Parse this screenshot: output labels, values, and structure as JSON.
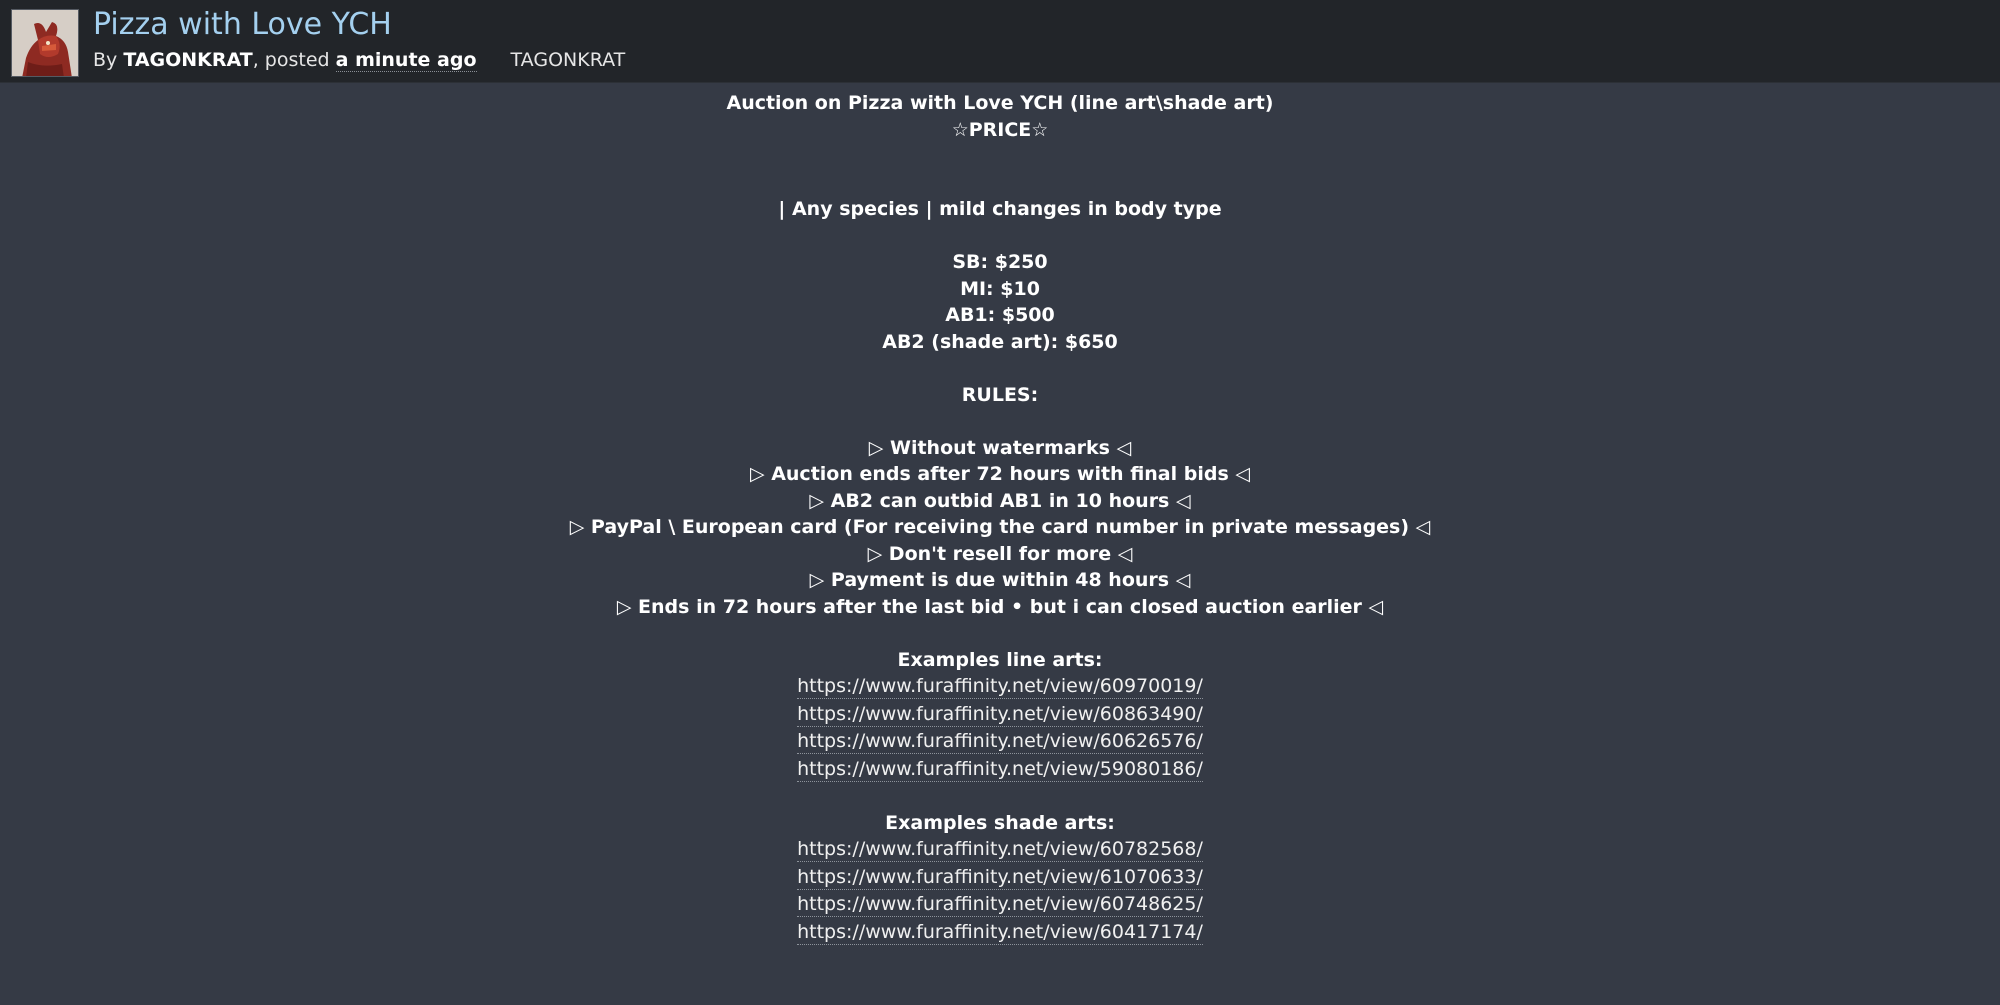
{
  "header": {
    "title": "Pizza with Love YCH",
    "by_prefix": "By",
    "author": "TAGONKRAT",
    "posted_prefix": ", posted",
    "posted_time": "a minute ago",
    "author_tag": "TAGONKRAT",
    "avatar_icon": "dragon-avatar"
  },
  "description": {
    "heading": "Auction on Pizza with Love YCH (line art\\shade art)",
    "price_label": "☆PRICE☆",
    "species_line": "| Any species | mild changes in body type",
    "prices": [
      "SB: $250",
      "MI: $10",
      "AB1: $500",
      "AB2 (shade art): $650"
    ],
    "rules_label": "RULES:",
    "rules": [
      "▷ Without watermarks ◁",
      "▷ Auction ends after 72 hours with final bids ◁",
      "▷ AB2 can outbid AB1 in 10 hours ◁",
      "▷ PayPal \\ European card (For receiving the card number in private messages) ◁",
      "▷ Don't resell for more ◁",
      "▷ Payment is due within 48 hours ◁",
      "▷ Ends in 72 hours after the last bid • but i can closed auction earlier ◁"
    ],
    "line_examples_label": "Examples line arts:",
    "line_examples": [
      "https://www.furaffinity.net/view/60970019/",
      "https://www.furaffinity.net/view/60863490/",
      "https://www.furaffinity.net/view/60626576/",
      "https://www.furaffinity.net/view/59080186/"
    ],
    "shade_examples_label": "Examples shade arts:",
    "shade_examples": [
      "https://www.furaffinity.net/view/60782568/",
      "https://www.furaffinity.net/view/61070633/",
      "https://www.furaffinity.net/view/60748625/",
      "https://www.furaffinity.net/view/60417174/"
    ]
  },
  "colors": {
    "page_bg": "#353a45",
    "header_bg": "#222529",
    "title": "#a4d0ef",
    "text": "#ffffff"
  }
}
